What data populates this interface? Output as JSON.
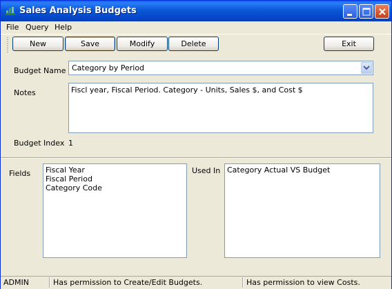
{
  "window": {
    "title": "Sales Analysis Budgets"
  },
  "menu": {
    "items": [
      {
        "label": "File"
      },
      {
        "label": "Query"
      },
      {
        "label": "Help"
      }
    ]
  },
  "toolbar": {
    "new_label": "New",
    "save_label": "Save",
    "modify_label": "Modify",
    "delete_label": "Delete",
    "exit_label": "Exit"
  },
  "form": {
    "budget_name_label": "Budget Name",
    "budget_name_value": "Category by Period",
    "notes_label": "Notes",
    "notes_value": "Fiscl year, Fiscal Period. Category - Units, Sales $, and Cost $",
    "budget_index_label": "Budget Index",
    "budget_index_value": "1"
  },
  "fields": {
    "label": "Fields",
    "items": [
      "Fiscal Year",
      "Fiscal Period",
      "Category Code"
    ]
  },
  "used_in": {
    "label": "Used In",
    "items": [
      "Category Actual VS Budget"
    ]
  },
  "status": {
    "user": "ADMIN",
    "permission_budgets": "Has permission to Create/Edit Budgets.",
    "permission_costs": "Has permission to view Costs."
  }
}
